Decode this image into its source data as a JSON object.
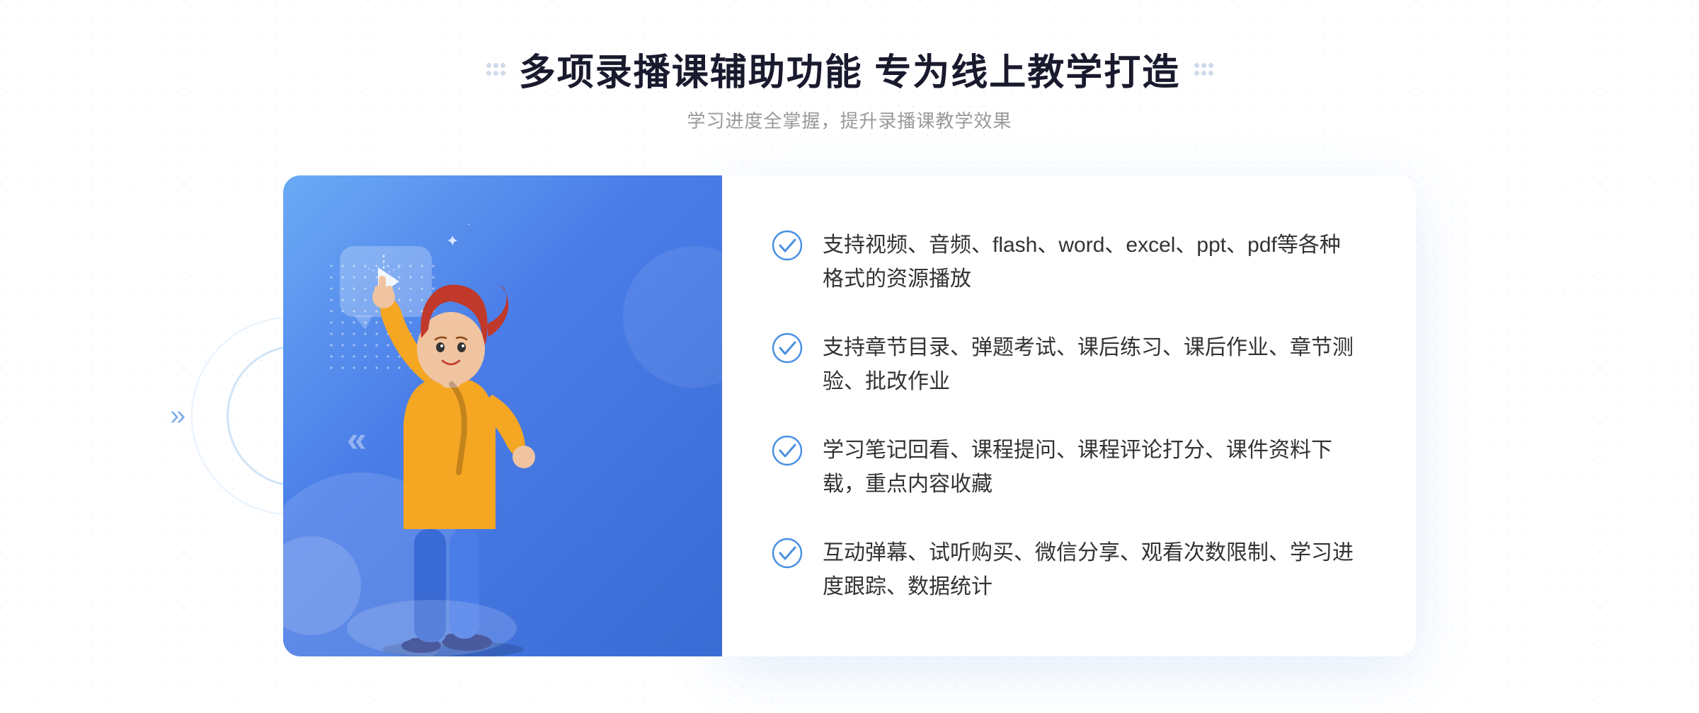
{
  "header": {
    "title": "多项录播课辅助功能 专为线上教学打造",
    "subtitle": "学习进度全掌握，提升录播课教学效果"
  },
  "features": [
    {
      "id": "feature-1",
      "text": "支持视频、音频、flash、word、excel、ppt、pdf等各种格式的资源播放"
    },
    {
      "id": "feature-2",
      "text": "支持章节目录、弹题考试、课后练习、课后作业、章节测验、批改作业"
    },
    {
      "id": "feature-3",
      "text": "学习笔记回看、课程提问、课程评论打分、课件资料下载，重点内容收藏"
    },
    {
      "id": "feature-4",
      "text": "互动弹幕、试听购买、微信分享、观看次数限制、学习进度跟踪、数据统计"
    }
  ],
  "decorations": {
    "left_arrow": "»",
    "sparkle": "✦"
  }
}
